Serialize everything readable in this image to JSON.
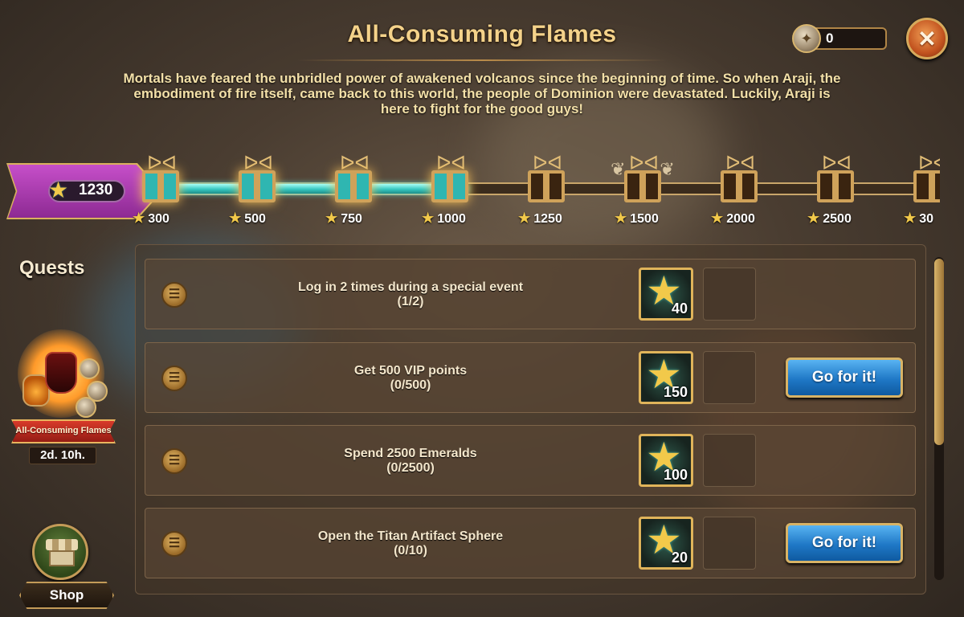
{
  "header": {
    "title": "All-Consuming Flames",
    "description": "Mortals have feared the unbridled power of awakened volcanos since the beginning of time. So when Araji, the embodiment of fire itself, came back to this world, the people of Dominion were devastated. Luckily, Araji is here to fight for the good guys!",
    "close_icon": "close-icon",
    "currency": {
      "value": "0",
      "icon": "event-coin-icon"
    }
  },
  "progress": {
    "points": "1230",
    "milestones": [
      {
        "label": "300",
        "done": true
      },
      {
        "label": "500",
        "done": true
      },
      {
        "label": "750",
        "done": true
      },
      {
        "label": "1000",
        "done": true
      },
      {
        "label": "1250",
        "done": false
      },
      {
        "label": "1500",
        "done": false,
        "winged": true
      },
      {
        "label": "2000",
        "done": false
      },
      {
        "label": "2500",
        "done": false
      },
      {
        "label": "30",
        "done": false
      }
    ]
  },
  "sidebar": {
    "heading": "Quests",
    "event_name": "All-Consuming Flames",
    "event_timer": "2d. 10h.",
    "shop_label": "Shop"
  },
  "quests": [
    {
      "title": "Log in 2 times during a special event",
      "progress": "(1/2)",
      "reward": "40",
      "button": ""
    },
    {
      "title": "Get 500 VIP points",
      "progress": "(0/500)",
      "reward": "150",
      "button": "Go for it!"
    },
    {
      "title": "Spend 2500 Emeralds",
      "progress": "(0/2500)",
      "reward": "100",
      "button": ""
    },
    {
      "title": "Open the Titan Artifact Sphere",
      "progress": "(0/10)",
      "reward": "20",
      "button": "Go for it!"
    }
  ],
  "colors": {
    "accent_gold": "#f4d28a",
    "progress_cyan": "#36c7c1",
    "points_purple": "#b33fb8",
    "button_blue": "#1f78c6",
    "close_orange": "#c2531f"
  }
}
